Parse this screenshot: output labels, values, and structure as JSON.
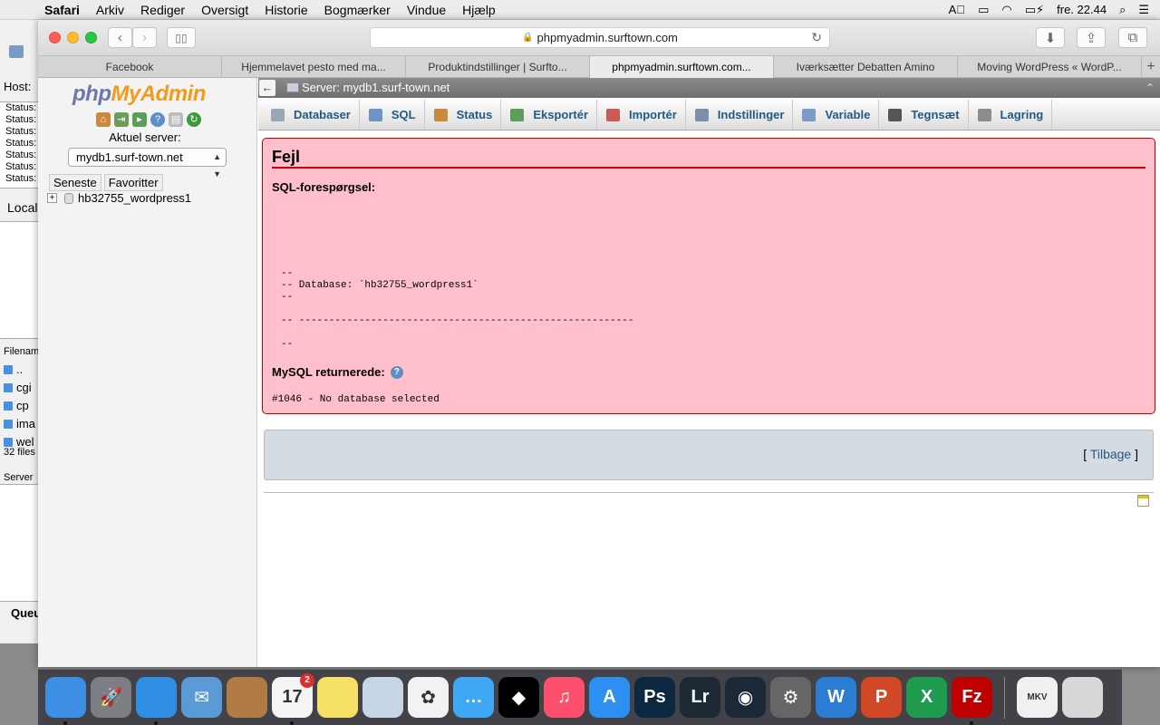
{
  "menubar": {
    "app": "Safari",
    "items": [
      "Arkiv",
      "Rediger",
      "Oversigt",
      "Historie",
      "Bogmærker",
      "Vindue",
      "Hjælp"
    ],
    "clock": "fre. 22.44"
  },
  "bgwindow": {
    "status_rows": [
      "Status:",
      "Status:",
      "Status:",
      "Status:",
      "Status:",
      "Status:",
      "Status:"
    ],
    "local_label": "Local",
    "filename_label": "Filenam",
    "files": [
      "..",
      "cgi",
      "cp",
      "ima",
      "wel"
    ],
    "file_count": "32 files",
    "server_label": "Server",
    "queue_label": "Queu"
  },
  "browser": {
    "url": "phpmyadmin.surftown.com",
    "tabs": [
      "Facebook",
      "Hjemmelavet pesto med ma...",
      "Produktindstillinger | Surfto...",
      "phpmyadmin.surftown.com...",
      "Iværksætter Debatten Amino",
      "Moving WordPress « WordP..."
    ],
    "active_tab": 3
  },
  "nav": {
    "logo_php": "php",
    "logo_myadmin": "MyAdmin",
    "server_label": "Aktuel server:",
    "server_value": "mydb1.surf-town.net",
    "tab_recent": "Seneste",
    "tab_favorites": "Favoritter",
    "database": "hb32755_wordpress1"
  },
  "main": {
    "server_breadcrumb": "Server: mydb1.surf-town.net",
    "menu": [
      {
        "label": "Databaser",
        "icon": "database-icon",
        "color": "#9aa7b5"
      },
      {
        "label": "SQL",
        "icon": "sql-icon",
        "color": "#6f94c4"
      },
      {
        "label": "Status",
        "icon": "status-icon",
        "color": "#c98a3c"
      },
      {
        "label": "Eksportér",
        "icon": "export-icon",
        "color": "#5b9e5b"
      },
      {
        "label": "Importér",
        "icon": "import-icon",
        "color": "#c95a5a"
      },
      {
        "label": "Indstillinger",
        "icon": "wrench-icon",
        "color": "#7b8fa8"
      },
      {
        "label": "Variable",
        "icon": "variable-icon",
        "color": "#7a9cc7"
      },
      {
        "label": "Tegnsæt",
        "icon": "charset-icon",
        "color": "#555555"
      },
      {
        "label": "Lagring",
        "icon": "engine-icon",
        "color": "#8c8c8c"
      }
    ],
    "error": {
      "title": "Fejl",
      "sql_label": "SQL-forespørgsel:",
      "sql_text": "--\n-- Database: `hb32755_wordpress1`\n--\n\n-- --------------------------------------------------------\n\n--",
      "mysql_label": "MySQL returnerede:",
      "error_code": "#1046 - No database selected"
    },
    "back_open": "[",
    "back_label": "Tilbage",
    "back_close": "]"
  },
  "dock": {
    "apps": [
      {
        "name": "finder-icon",
        "label": "",
        "color": "#3d8fe6",
        "running": true
      },
      {
        "name": "launchpad-icon",
        "label": "🚀",
        "color": "#7d7d84",
        "running": false
      },
      {
        "name": "safari-icon",
        "label": "",
        "color": "#2d8ee4",
        "running": true
      },
      {
        "name": "mail-icon",
        "label": "✉",
        "color": "#5b9bd5",
        "running": false
      },
      {
        "name": "contacts-icon",
        "label": "",
        "color": "#b07b45",
        "running": false
      },
      {
        "name": "calendar-icon",
        "label": "17",
        "color": "#f4f4f4",
        "running": true,
        "badge": "2"
      },
      {
        "name": "notes-icon",
        "label": "",
        "color": "#f7e066",
        "running": false
      },
      {
        "name": "preview-icon",
        "label": "",
        "color": "#c7d6e6",
        "running": false
      },
      {
        "name": "photos-icon",
        "label": "✿",
        "color": "#f2f2f2",
        "running": false
      },
      {
        "name": "messages-icon",
        "label": "…",
        "color": "#3fa8f4",
        "running": false
      },
      {
        "name": "tidal-icon",
        "label": "◆",
        "color": "#000000",
        "running": false
      },
      {
        "name": "itunes-icon",
        "label": "♫",
        "color": "#fb4f6c",
        "running": false
      },
      {
        "name": "appstore-icon",
        "label": "A",
        "color": "#2e8ff2",
        "running": false
      },
      {
        "name": "photoshop-icon",
        "label": "Ps",
        "color": "#0c2740",
        "running": false
      },
      {
        "name": "lightroom-icon",
        "label": "Lr",
        "color": "#1d2a34",
        "running": false
      },
      {
        "name": "steam-icon",
        "label": "◉",
        "color": "#1b2838",
        "running": false
      },
      {
        "name": "system-preferences-icon",
        "label": "⚙",
        "color": "#666666",
        "running": false
      },
      {
        "name": "word-icon",
        "label": "W",
        "color": "#2b7cd3",
        "running": false
      },
      {
        "name": "powerpoint-icon",
        "label": "P",
        "color": "#d24726",
        "running": false
      },
      {
        "name": "excel-icon",
        "label": "X",
        "color": "#1f9b4f",
        "running": false
      },
      {
        "name": "filezilla-icon",
        "label": "Fz",
        "color": "#bf0000",
        "running": true
      }
    ],
    "stack": [
      {
        "name": "downloads-stack-icon",
        "label": "MKV",
        "color": "#f0f0f0"
      },
      {
        "name": "trash-icon",
        "label": "",
        "color": "#d8d8d8"
      }
    ]
  }
}
